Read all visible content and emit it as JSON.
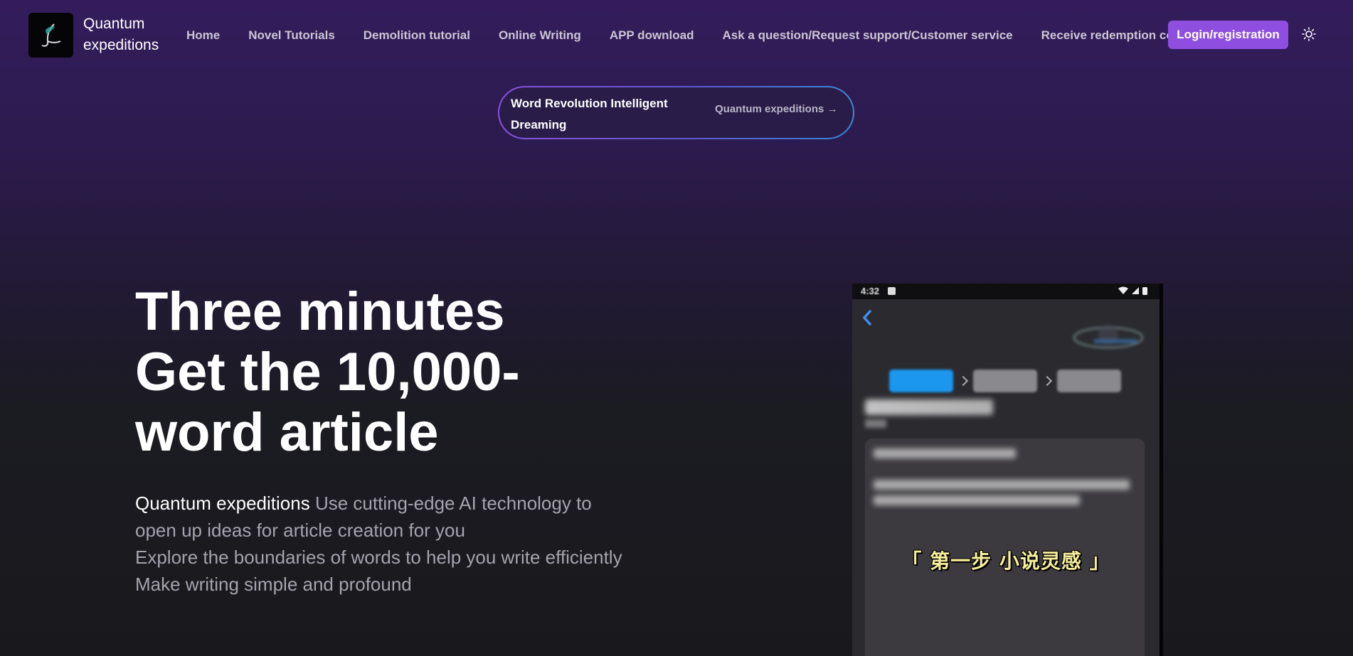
{
  "header": {
    "brand_name": "Quantum expeditions",
    "nav_items": [
      {
        "label": "Home"
      },
      {
        "label": "Novel Tutorials"
      },
      {
        "label": "Demolition tutorial"
      },
      {
        "label": "Online Writing"
      },
      {
        "label": "APP download"
      },
      {
        "label": "Ask a question/Request support/Customer service"
      },
      {
        "label": "Receive redemption code"
      }
    ],
    "login_label": "Login/registration",
    "theme_icon": "sun-icon"
  },
  "announcement": {
    "title": "Word Revolution Intelligent Dreaming",
    "link_label": "Quantum expeditions →"
  },
  "hero": {
    "title_lines": [
      "Three minutes",
      "Get the 10,000-",
      "word article"
    ],
    "desc_brand": "Quantum expeditions",
    "desc_rest": "Use cutting-edge AI technology to open up ideas for article creation for you",
    "desc_line2": "Explore the boundaries of words to help you write efficiently",
    "desc_line3": "Make writing simple and profound"
  },
  "preview": {
    "status_time": "4:32",
    "caption": "「 第一步 小说灵感 」"
  },
  "colors": {
    "accent": "#8e4fe0",
    "step_active": "#1c97f0",
    "caption": "#f7ee9a"
  }
}
